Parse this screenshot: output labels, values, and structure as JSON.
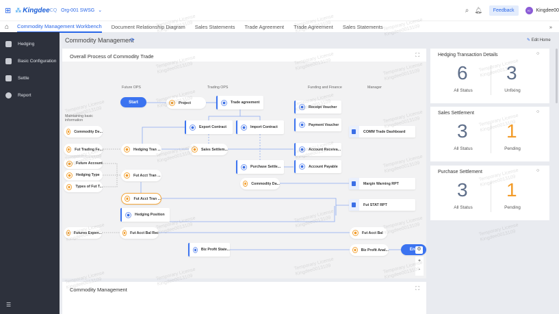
{
  "header": {
    "logo": "Kingdee",
    "logo_suffix": "CQ",
    "org": "Org-001 SWSG",
    "feedback": "Feedback",
    "avatar_initials": "KI",
    "user": "Kingdee00"
  },
  "tabs": [
    "Commodity Management Workbench",
    "Document Relationship Diagram",
    "Sales Statements",
    "Trade Agreement",
    "Trade Agreement",
    "Sales Statements"
  ],
  "sidebar": [
    "Hedging",
    "Basic Configuration",
    "Settle",
    "Report"
  ],
  "page": {
    "title": "Commodity Management",
    "edit_home": "Edit Home"
  },
  "process": {
    "title": "Overall Process of Commodity Trade",
    "columns": [
      "Future OPS",
      "Trading OPS",
      "Funding and Finance",
      "Manager",
      "Maintaining basic information"
    ],
    "start": "Start",
    "end": "End",
    "nodes": [
      "Project",
      "Trade agreement",
      "Export Contract",
      "Import Contract",
      "Hedging Tran ...",
      "Sales Settlem...",
      "Purchase Settle...",
      "Commodity Da...",
      "Commodity De...",
      "Fut Trading Fe...",
      "Future Account",
      "Hedging Type",
      "Types of Fut T...",
      "Fut Acct Tran ...",
      "Fut Acct Tran ...",
      "Hedging Position",
      "Futures Expen...",
      "Fut Acct Bal Rec",
      "Biz Profit State...",
      "Receipt Voucher",
      "Payment Voucher",
      "COMM Trade Dashboard",
      "Account Receiva...",
      "Account Payable",
      "Margin Warning RPT",
      "Fut STAT RPT",
      "Fut Acct Bal",
      "Biz Profit Anal..."
    ],
    "zoom_in": "+",
    "zoom_out": "-"
  },
  "cards": [
    {
      "title": "Hedging Transaction Details",
      "a": "6",
      "a_label": "All Status",
      "b": "3",
      "b_label": "Unfixing"
    },
    {
      "title": "Sales Settlement",
      "a": "3",
      "a_label": "All Status",
      "b": "1",
      "b_label": "Pending"
    },
    {
      "title": "Purchase Settlement",
      "a": "3",
      "a_label": "All Status",
      "b": "1",
      "b_label": "Pending"
    }
  ],
  "bottom": {
    "title": "Commodity Management"
  },
  "watermark": "Temporary License Kingdee0013109",
  "colors": {
    "accent": "#2765e8",
    "orange": "#f29b28",
    "sidebar": "#2d313c"
  }
}
